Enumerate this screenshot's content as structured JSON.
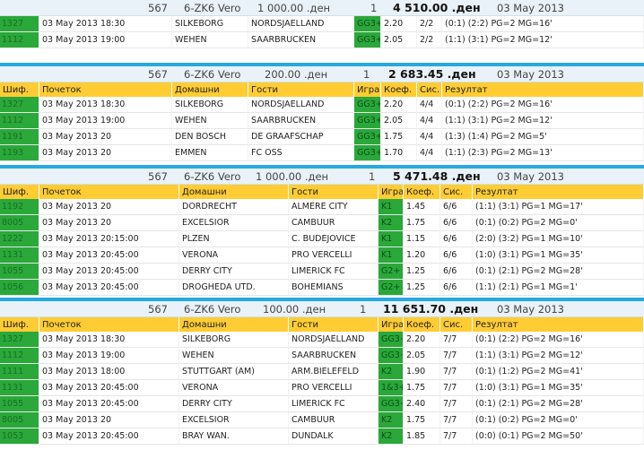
{
  "columns": [
    "Шиф.",
    "Почеток",
    "Домашни",
    "Гости",
    "Игра",
    "Коеф.",
    "Сис.",
    "Резултат"
  ],
  "tickets": [
    {
      "id": "567",
      "type": "6-ZK6 Vero",
      "stake": "1 000.00 .ден",
      "count": "1",
      "payout": "4 510.00 .ден",
      "date": "03 May 2013",
      "show_header": false,
      "rows": [
        [
          "1327",
          "03 May 2013 18:30",
          "SILKEBORG",
          "NORDSJAELLAND",
          "GG3+",
          "2.20",
          "2/2",
          "(0:1) (2:2) PG=2 MG=16'"
        ],
        [
          "1112",
          "03 May 2013 19:00",
          "WEHEN",
          "SAARBRUCKEN",
          "GG3+",
          "2.05",
          "2/2",
          "(1:1) (3:1) PG=2 MG=12'"
        ]
      ]
    },
    {
      "id": "567",
      "type": "6-ZK6 Vero",
      "stake": "200.00 .ден",
      "count": "1",
      "payout": "2 683.45 .ден",
      "date": "03 May 2013",
      "show_header": true,
      "rows": [
        [
          "1327",
          "03 May 2013 18:30",
          "SILKEBORG",
          "NORDSJAELLAND",
          "GG3+",
          "2.20",
          "4/4",
          "(0:1) (2:2) PG=2 MG=16'"
        ],
        [
          "1112",
          "03 May 2013 19:00",
          "WEHEN",
          "SAARBRUCKEN",
          "GG3+",
          "2.05",
          "4/4",
          "(1:1) (3:1) PG=2 MG=12'"
        ],
        [
          "1191",
          "03 May 2013 20",
          "DEN BOSCH",
          "DE GRAAFSCHAP",
          "GG3+",
          "1.75",
          "4/4",
          "(1:3) (1:4) PG=2 MG=5'"
        ],
        [
          "1193",
          "03 May 2013 20",
          "EMMEN",
          "FC OSS",
          "GG3+",
          "1.70",
          "4/4",
          "(1:1) (2:3) PG=2 MG=13'"
        ]
      ]
    },
    {
      "id": "567",
      "type": "6-ZK6 Vero",
      "stake": "1 000.00 .ден",
      "count": "1",
      "payout": "5 471.48 .ден",
      "date": "03 May 2013",
      "show_header": true,
      "rows": [
        [
          "1192",
          "03 May 2013 20",
          "DORDRECHT",
          "ALMERE CITY",
          "K1",
          "1.45",
          "6/6",
          "(1:1) (3:1) PG=1 MG=17'"
        ],
        [
          "8005",
          "03 May 2013 20",
          "EXCELSIOR",
          "CAMBUUR",
          "K2",
          "1.75",
          "6/6",
          "(0:1) (0:2) PG=2 MG=0'"
        ],
        [
          "1222",
          "03 May 2013 20:15:00",
          "PLZEN",
          "C. BUDEJOVICE",
          "K1",
          "1.15",
          "6/6",
          "(2:0) (3:2) PG=1 MG=10'"
        ],
        [
          "1131",
          "03 May 2013 20:45:00",
          "VERONA",
          "PRO VERCELLI",
          "K1",
          "1.20",
          "6/6",
          "(1:0) (3:1) PG=1 MG=35'"
        ],
        [
          "1055",
          "03 May 2013 20:45:00",
          "DERRY CITY",
          "LIMERICK FC",
          "G2+",
          "1.25",
          "6/6",
          "(0:1) (2:1) PG=2 MG=28'"
        ],
        [
          "1056",
          "03 May 2013 20:45:00",
          "DROGHEDA UTD.",
          "BOHEMIANS",
          "G2+",
          "1.25",
          "6/6",
          "(1:1) (2:1) PG=1 MG=1'"
        ]
      ]
    },
    {
      "id": "567",
      "type": "6-ZK6 Vero",
      "stake": "100.00 .ден",
      "count": "1",
      "payout": "11 651.70 .ден",
      "date": "03 May 2013",
      "show_header": true,
      "rows": [
        [
          "1327",
          "03 May 2013 18:30",
          "SILKEBORG",
          "NORDSJAELLAND",
          "GG3+",
          "2.20",
          "7/7",
          "(0:1) (2:2) PG=2 MG=16'"
        ],
        [
          "1112",
          "03 May 2013 19:00",
          "WEHEN",
          "SAARBRUCKEN",
          "GG3+",
          "2.05",
          "7/7",
          "(1:1) (3:1) PG=2 MG=12'"
        ],
        [
          "1111",
          "03 May 2013 18:00",
          "STUTTGART (AM)",
          "ARM.BIELEFELD",
          "K2",
          "1.90",
          "7/7",
          "(0:1) (1:2) PG=2 MG=41'"
        ],
        [
          "1131",
          "03 May 2013 20:45:00",
          "VERONA",
          "PRO VERCELLI",
          "1&3+",
          "1.75",
          "7/7",
          "(1:0) (3:1) PG=1 MG=35'"
        ],
        [
          "1055",
          "03 May 2013 20:45:00",
          "DERRY CITY",
          "LIMERICK FC",
          "GG3+",
          "2.40",
          "7/7",
          "(0:1) (2:1) PG=2 MG=28'"
        ],
        [
          "8005",
          "03 May 2013 20",
          "EXCELSIOR",
          "CAMBUUR",
          "K2",
          "1.75",
          "7/7",
          "(0:1) (0:2) PG=2 MG=0'"
        ],
        [
          "1053",
          "03 May 2013 20:45:00",
          "BRAY WAN.",
          "DUNDALK",
          "K2",
          "1.85",
          "7/7",
          "(0:0) (0:1) PG=2 MG=50'"
        ]
      ]
    }
  ]
}
